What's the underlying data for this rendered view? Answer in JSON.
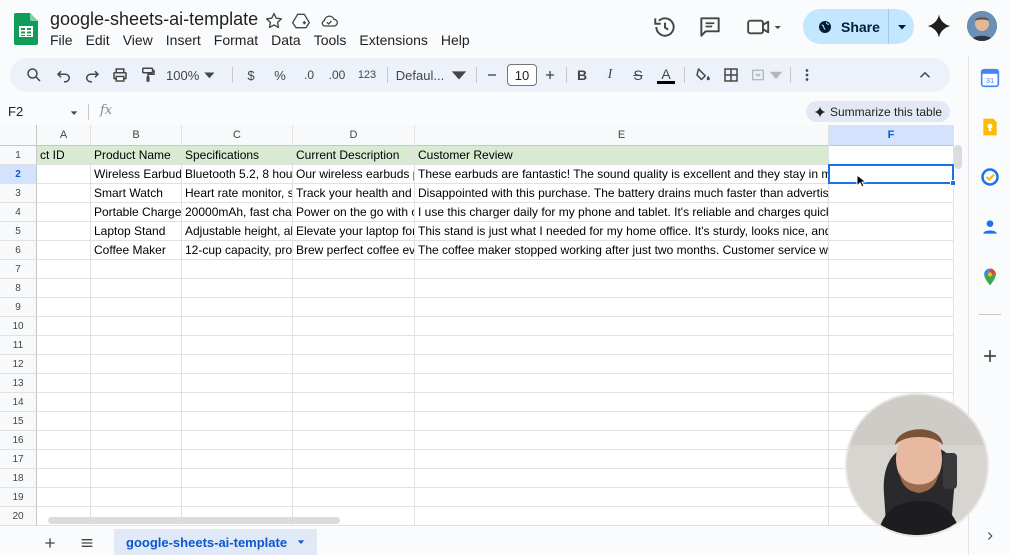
{
  "doc": {
    "title": "google-sheets-ai-template",
    "menu": [
      "File",
      "Edit",
      "View",
      "Insert",
      "Format",
      "Data",
      "Tools",
      "Extensions",
      "Help"
    ],
    "share_label": "Share"
  },
  "toolbar": {
    "zoom": "100%",
    "currency": "$",
    "percent": "%",
    "dec_decrease": ".0",
    "dec_increase": ".00",
    "number_format": "123",
    "font": "Defaul...",
    "font_size": "10",
    "bold": "B",
    "italic": "I",
    "strike": "S",
    "text_color_letter": "A"
  },
  "formula_bar": {
    "name_box": "F2",
    "fx": "fx",
    "formula": "",
    "summarize_label": "Summarize this table"
  },
  "grid": {
    "columns": [
      "A",
      "B",
      "C",
      "D",
      "E",
      "F"
    ],
    "selected_column": "F",
    "rows": [
      "1",
      "2",
      "3",
      "4",
      "5",
      "6",
      "7",
      "8",
      "9",
      "10",
      "11",
      "12",
      "13",
      "14",
      "15",
      "16",
      "17",
      "18",
      "19",
      "20"
    ],
    "selected_row": "2",
    "header_row": [
      "ct ID",
      "Product Name",
      "Specifications",
      "Current Description",
      "Customer Review",
      ""
    ],
    "data_rows": [
      [
        "",
        "Wireless Earbud",
        "Bluetooth 5.2, 8 hou",
        "Our wireless earbuds p",
        "These earbuds are fantastic! The sound quality is excellent and they stay in m",
        ""
      ],
      [
        "",
        "Smart Watch",
        "Heart rate monitor, s",
        "Track your health and s",
        "Disappointed with this purchase. The battery drains much faster than advertise",
        ""
      ],
      [
        "",
        "Portable Charge",
        "20000mAh, fast char",
        "Power on the go with o",
        "I use this charger daily for my phone and tablet. It's reliable and charges quick",
        ""
      ],
      [
        "",
        "Laptop Stand",
        "Adjustable height, al",
        "Elevate your laptop for",
        "This stand is just what I needed for my home office. It's sturdy, looks nice, and",
        ""
      ],
      [
        "",
        "Coffee Maker",
        "12-cup capacity, pro",
        "Brew perfect coffee eve",
        "The coffee maker stopped working after just two months. Customer service wa",
        ""
      ]
    ],
    "selected_cell": "F2"
  },
  "tabs": {
    "sheet_name": "google-sheets-ai-template"
  },
  "colors": {
    "header_fill": "#d9ead3",
    "selection": "#1a73e8",
    "share_bg": "#c2e7ff",
    "toolbar_bg": "#edf2fa"
  },
  "side_panel": {
    "icons": [
      "calendar-icon",
      "keep-icon",
      "tasks-icon",
      "contacts-icon",
      "maps-icon",
      "add-icon"
    ]
  }
}
